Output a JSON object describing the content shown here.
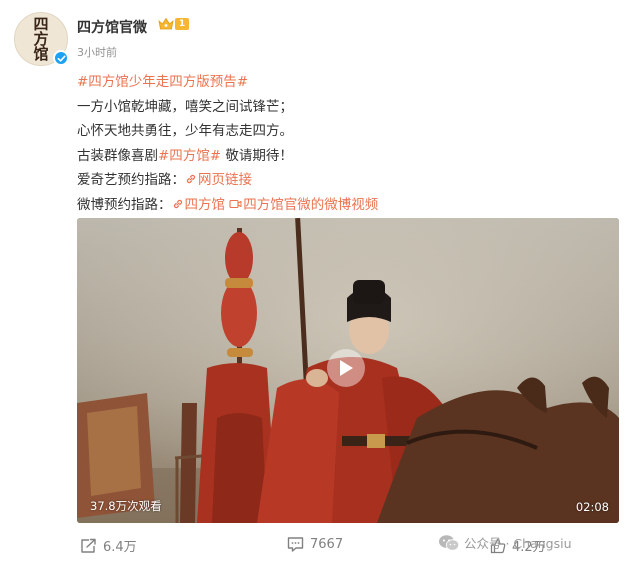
{
  "account": {
    "avatar_text": "四方馆",
    "name": "四方馆官微",
    "vip_level": "1",
    "timestamp": "3小时前"
  },
  "post": {
    "hashtag_title": "#四方馆少年走四方版预告#",
    "line_1": "一方小馆乾坤藏，嘻笑之间试锋芒；",
    "line_2": "心怀天地共勇往，少年有志走四方。",
    "line_3_prefix": "古装群像喜剧",
    "line_3_tag": "#四方馆#",
    "line_3_suffix": " 敬请期待！",
    "line_4_prefix": "爱奇艺预约指路：",
    "line_4_link": "网页链接",
    "line_5_prefix": "微博预约指路：",
    "line_5_link_1": "四方馆",
    "line_5_link_2": "四方馆官微的微博视频"
  },
  "video": {
    "view_count": "37.8万次观看",
    "duration": "02:08"
  },
  "actions": {
    "repost_count": "6.4万",
    "comment_count": "7667",
    "like_count": "4.2万"
  },
  "watermark": {
    "text": "公众号 · Changsiu"
  },
  "colors": {
    "link": "#eb7350",
    "vip_badge": "#f5b731",
    "verified": "#1da1f2"
  }
}
